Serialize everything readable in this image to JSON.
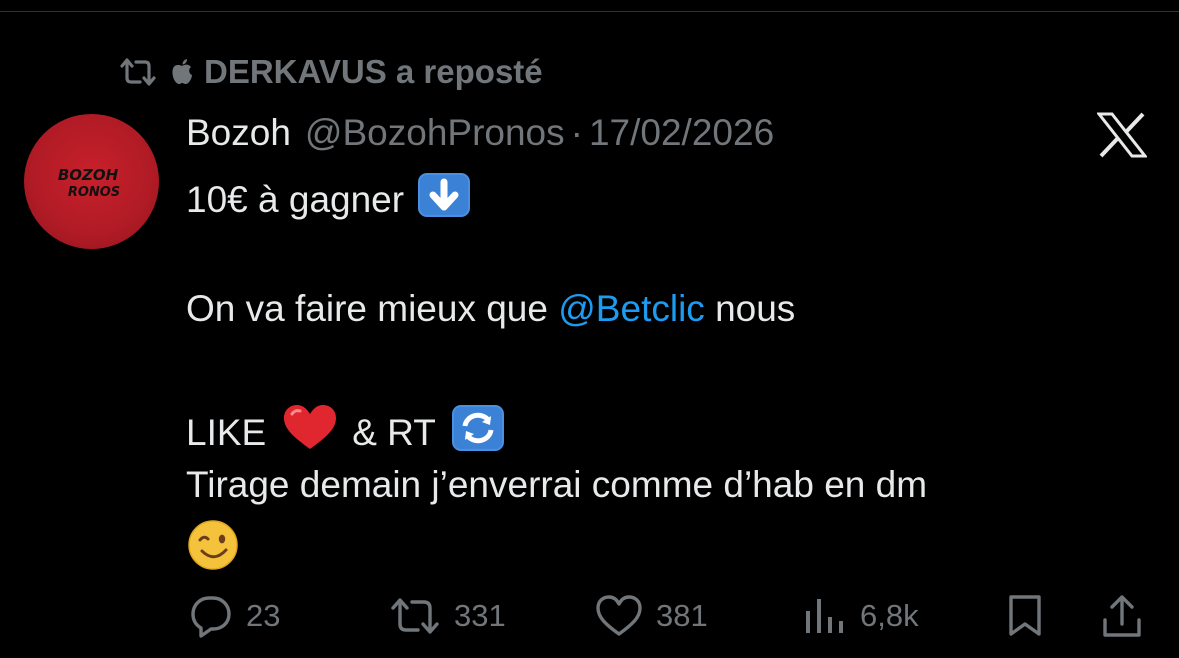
{
  "repost": {
    "user": "DERKAVUS",
    "label": "DERKAVUS a reposté"
  },
  "tweet": {
    "avatar_text_top": "BOZOH",
    "avatar_text_bottom": "RONOS",
    "name": "Bozoh",
    "handle": "@BozohPronos",
    "separator": "·",
    "date": "17/02/2026",
    "line1": "10€ à gagner",
    "line2_pre": "On va faire mieux que ",
    "line2_mention": "@Betclic",
    "line2_post": " nous",
    "line3_a": "LIKE",
    "line3_b": "& RT",
    "line4": "Tirage demain j’enverrai comme d’hab en dm"
  },
  "icons": {
    "repost": "repost-icon",
    "apple": "apple-icon",
    "platform": "x-logo-icon",
    "down_arrow": "down-arrow-emoji",
    "heart": "red-heart-emoji",
    "refresh": "counterclockwise-arrows-emoji",
    "wink": "winking-face-emoji"
  },
  "actions": {
    "replies": "23",
    "reposts": "331",
    "likes": "381",
    "views": "6,8k"
  },
  "colors": {
    "mention": "#1d9bf0",
    "muted": "#71767b",
    "text": "#e7e9ea",
    "avatar": "#b01b25"
  }
}
